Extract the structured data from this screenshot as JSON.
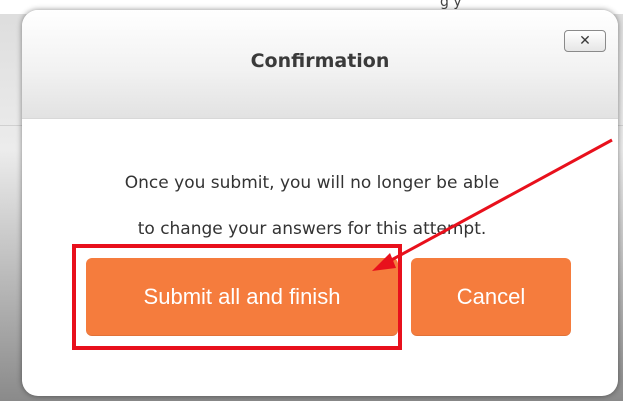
{
  "background": {
    "snippet": "g y",
    "color": "#6e6e6e"
  },
  "dialog": {
    "title": "Confirmation",
    "close_icon": "close-x-icon",
    "close_label": "✕",
    "message_lines": [
      "Once you submit, you will no longer be able",
      "to change your answers for this attempt."
    ],
    "buttons": {
      "submit_label": "Submit all and finish",
      "cancel_label": "Cancel"
    },
    "colors": {
      "button": "#f57c3d",
      "title_text": "#3a3a3a",
      "body_text": "#333333"
    }
  },
  "annotation": {
    "color": "#e8101c",
    "kind": "highlight-box-with-arrow",
    "target": "submit-button"
  }
}
